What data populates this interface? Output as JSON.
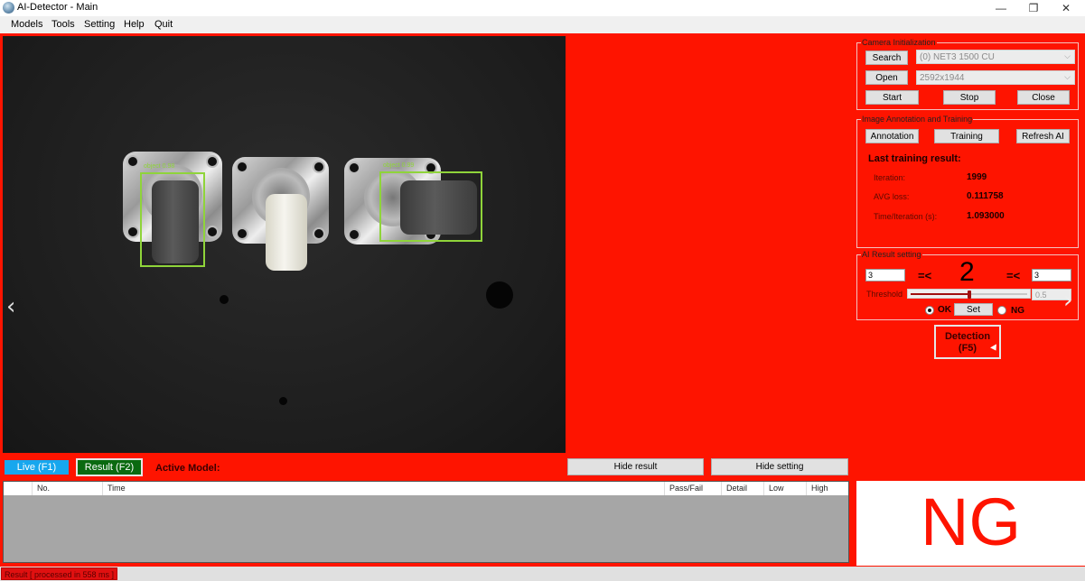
{
  "window": {
    "title": "AI-Detector - Main",
    "controls": {
      "minimize": "—",
      "maximize": "❐",
      "close": "✕"
    }
  },
  "menu": [
    "Models",
    "Tools",
    "Setting",
    "Help",
    "Quit"
  ],
  "camera_view": {
    "nav_prev": "‹",
    "detections": [
      {
        "label": "object 0.98"
      },
      {
        "label": "object 0.99"
      }
    ]
  },
  "camera_init": {
    "legend": "Camera Initialization",
    "search_label": "Search",
    "open_label": "Open",
    "camera_selected": "(0) NET3 1500 CU",
    "resolution_selected": "2592x1944",
    "start_label": "Start",
    "stop_label": "Stop",
    "close_label": "Close",
    "chevron": "⌵"
  },
  "training": {
    "legend": "Image Annotation and Training",
    "annotation_label": "Annotation",
    "training_label": "Training",
    "refresh_label": "Refresh AI",
    "heading": "Last training result:",
    "rows": [
      {
        "label": "Iteration:",
        "value": "1999"
      },
      {
        "label": "AVG loss:",
        "value": "0.111758"
      },
      {
        "label": "Time/Iteration (s):",
        "value": "1.093000"
      }
    ]
  },
  "ai_result": {
    "legend": "AI Result setting",
    "low": "3",
    "high": "3",
    "cmp_symbol": "=<",
    "count": "2",
    "threshold_label": "Threshold",
    "threshold_value": "0.5",
    "threshold_fraction": 0.5,
    "ok_label": "OK",
    "ng_label": "NG",
    "set_label": "Set",
    "selected": "OK",
    "nav_next": "›"
  },
  "detection_button": {
    "line1": "Detection",
    "line2": "(F5)"
  },
  "bottom_bar": {
    "live_label": "Live (F1)",
    "result_label": "Result (F2)",
    "active_model_label": "Active Model:",
    "hide_result_label": "Hide result",
    "hide_setting_label": "Hide setting"
  },
  "table": {
    "columns": [
      "",
      "No.",
      "Time",
      "Pass/Fail",
      "Detail",
      "Low",
      "High"
    ],
    "rows": []
  },
  "status_panel": {
    "text": "NG",
    "color": "#fe1400"
  },
  "statusbar": {
    "message": "Result [ processed in 558 ms ]"
  },
  "colors": {
    "background": "#fe1400",
    "live": "#17a7ee",
    "result": "#0a6a10",
    "box": "#8fd43a"
  }
}
